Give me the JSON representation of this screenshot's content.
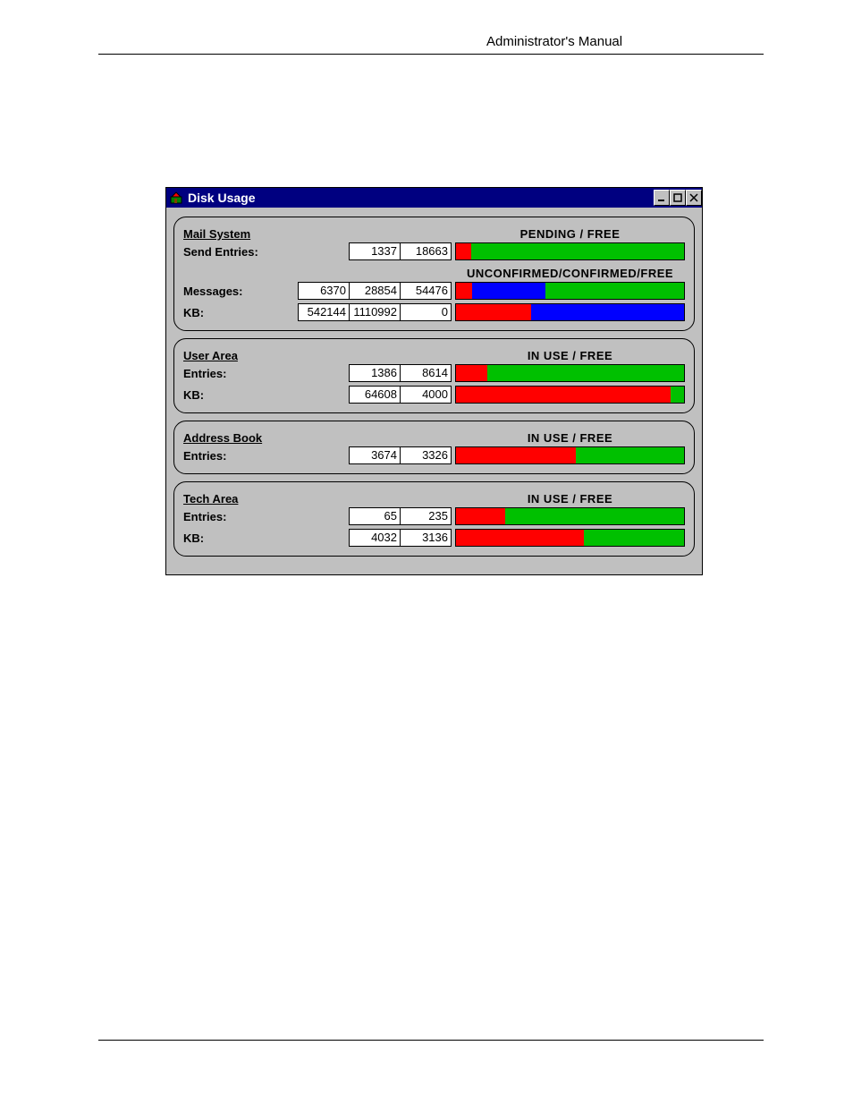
{
  "doc": {
    "header": "Administrator's Manual"
  },
  "window": {
    "title": "Disk Usage",
    "buttons": {
      "minimize": "_",
      "maximize": "□",
      "close": "×"
    }
  },
  "legends": {
    "pending_free": "PENDING     /     FREE",
    "ucf": "UNCONFIRMED/CONFIRMED/FREE",
    "inuse_free": "IN USE     /     FREE"
  },
  "sections": {
    "mail": {
      "title": "Mail System",
      "rows": {
        "send_entries": {
          "label": "Send Entries:",
          "vals": [
            "1337",
            "18663"
          ],
          "segs": [
            {
              "cls": "red",
              "pct": 6.7
            },
            {
              "cls": "green",
              "pct": 93.3
            }
          ]
        },
        "messages": {
          "label": "Messages:",
          "vals": [
            "6370",
            "28854",
            "54476"
          ],
          "segs": [
            {
              "cls": "red",
              "pct": 7.1
            },
            {
              "cls": "blue",
              "pct": 32.2
            },
            {
              "cls": "green",
              "pct": 60.7
            }
          ]
        },
        "kb": {
          "label": "KB:",
          "vals": [
            "542144",
            "1110992",
            "0"
          ],
          "segs": [
            {
              "cls": "red",
              "pct": 32.8
            },
            {
              "cls": "blue",
              "pct": 67.2
            },
            {
              "cls": "green",
              "pct": 0
            }
          ]
        }
      }
    },
    "user": {
      "title": "User Area",
      "rows": {
        "entries": {
          "label": "Entries:",
          "vals": [
            "1386",
            "8614"
          ],
          "segs": [
            {
              "cls": "red",
              "pct": 13.9
            },
            {
              "cls": "green",
              "pct": 86.1
            }
          ]
        },
        "kb": {
          "label": "KB:",
          "vals": [
            "64608",
            "4000"
          ],
          "segs": [
            {
              "cls": "red",
              "pct": 94.2
            },
            {
              "cls": "green",
              "pct": 5.8
            }
          ]
        }
      }
    },
    "addr": {
      "title": "Address Book",
      "rows": {
        "entries": {
          "label": "Entries:",
          "vals": [
            "3674",
            "3326"
          ],
          "segs": [
            {
              "cls": "red",
              "pct": 52.5
            },
            {
              "cls": "green",
              "pct": 47.5
            }
          ]
        }
      }
    },
    "tech": {
      "title": "Tech Area",
      "rows": {
        "entries": {
          "label": "Entries:",
          "vals": [
            "65",
            "235"
          ],
          "segs": [
            {
              "cls": "red",
              "pct": 21.7
            },
            {
              "cls": "green",
              "pct": 78.3
            }
          ]
        },
        "kb": {
          "label": "KB:",
          "vals": [
            "4032",
            "3136"
          ],
          "segs": [
            {
              "cls": "red",
              "pct": 56.2
            },
            {
              "cls": "green",
              "pct": 43.8
            }
          ]
        }
      }
    }
  },
  "chart_data": [
    {
      "type": "bar",
      "title": "Mail System — Send Entries",
      "categories": [
        "Pending",
        "Free"
      ],
      "values": [
        1337,
        18663
      ]
    },
    {
      "type": "bar",
      "title": "Mail System — Messages",
      "categories": [
        "Unconfirmed",
        "Confirmed",
        "Free"
      ],
      "values": [
        6370,
        28854,
        54476
      ]
    },
    {
      "type": "bar",
      "title": "Mail System — KB",
      "categories": [
        "Unconfirmed",
        "Confirmed",
        "Free"
      ],
      "values": [
        542144,
        1110992,
        0
      ]
    },
    {
      "type": "bar",
      "title": "User Area — Entries",
      "categories": [
        "In Use",
        "Free"
      ],
      "values": [
        1386,
        8614
      ]
    },
    {
      "type": "bar",
      "title": "User Area — KB",
      "categories": [
        "In Use",
        "Free"
      ],
      "values": [
        64608,
        4000
      ]
    },
    {
      "type": "bar",
      "title": "Address Book — Entries",
      "categories": [
        "In Use",
        "Free"
      ],
      "values": [
        3674,
        3326
      ]
    },
    {
      "type": "bar",
      "title": "Tech Area — Entries",
      "categories": [
        "In Use",
        "Free"
      ],
      "values": [
        65,
        235
      ]
    },
    {
      "type": "bar",
      "title": "Tech Area — KB",
      "categories": [
        "In Use",
        "Free"
      ],
      "values": [
        4032,
        3136
      ]
    }
  ]
}
